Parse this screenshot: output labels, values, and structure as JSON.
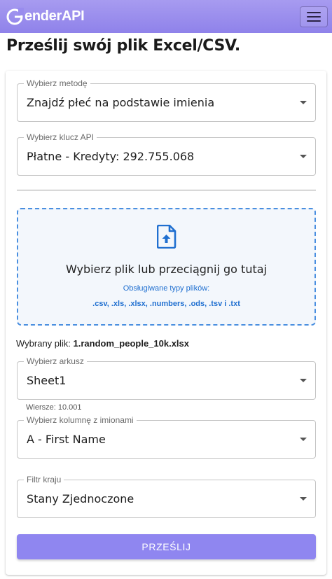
{
  "app": {
    "logo_text": "enderAPI",
    "menu_icon": "hamburger-menu-icon",
    "brand_color": "#998cee"
  },
  "page": {
    "title": "Prześlij swój plik Excel/CSV."
  },
  "form": {
    "method": {
      "label": "Wybierz metodę",
      "value": "Znajdź płeć na podstawie imienia"
    },
    "api_key": {
      "label": "Wybierz klucz API",
      "value": "Płatne - Kredyty: 292.755.068"
    },
    "dropzone": {
      "icon": "file-upload-icon",
      "main_text": "Wybierz plik lub przeciągnij go tutaj",
      "supported_label": "Obsługiwane typy plików:",
      "supported_types": ".csv, .xls, .xlsx, .numbers, .ods, .tsv i .txt"
    },
    "selected_file": {
      "label": "Wybrany plik:",
      "name": "1.random_people_10k.xlsx"
    },
    "sheet": {
      "label": "Wybierz arkusz",
      "value": "Sheet1"
    },
    "rows_info": "Wiersze: 10.001",
    "column": {
      "label": "Wybierz kolumnę z imionami",
      "value": "A - First Name"
    },
    "country": {
      "label": "Filtr kraju",
      "value": "Stany Zjednoczone"
    },
    "submit_label": "PRZEŚLIJ",
    "accent_color": "#4a8fe0",
    "submit_color": "#8f86f0"
  }
}
